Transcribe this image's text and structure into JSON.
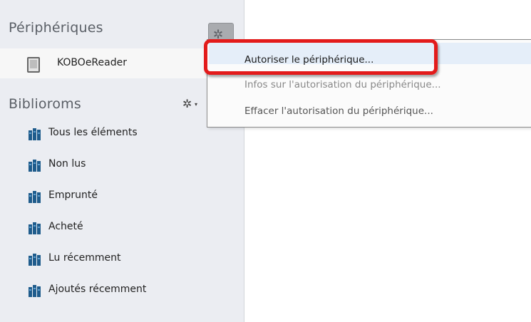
{
  "sidebar": {
    "devices_header": "Périphériques",
    "device": {
      "name": "KOBOeReader",
      "icon": "ereader-icon"
    },
    "devices_gear_icon": "gear-icon",
    "bookshelves_header": "Biblioroms",
    "bookshelves_gear_icon": "gear-icon",
    "items": [
      {
        "label": "Tous les éléments",
        "icon": "books-icon"
      },
      {
        "label": "Non lus",
        "icon": "books-icon"
      },
      {
        "label": "Emprunté",
        "icon": "books-icon"
      },
      {
        "label": "Acheté",
        "icon": "books-icon"
      },
      {
        "label": "Lu récemment",
        "icon": "books-icon"
      },
      {
        "label": "Ajoutés récemment",
        "icon": "books-icon"
      }
    ]
  },
  "menu": {
    "items": [
      {
        "label": "Autoriser le périphérique..."
      },
      {
        "label": "Infos sur l'autorisation du périphérique..."
      },
      {
        "label": "Effacer l'autorisation du périphérique..."
      }
    ]
  },
  "colors": {
    "sidebar_bg": "#ebedf2",
    "highlight": "#e31b1b",
    "menu_hover": "#e5eef9",
    "book_icon": "#1f5c8c"
  }
}
